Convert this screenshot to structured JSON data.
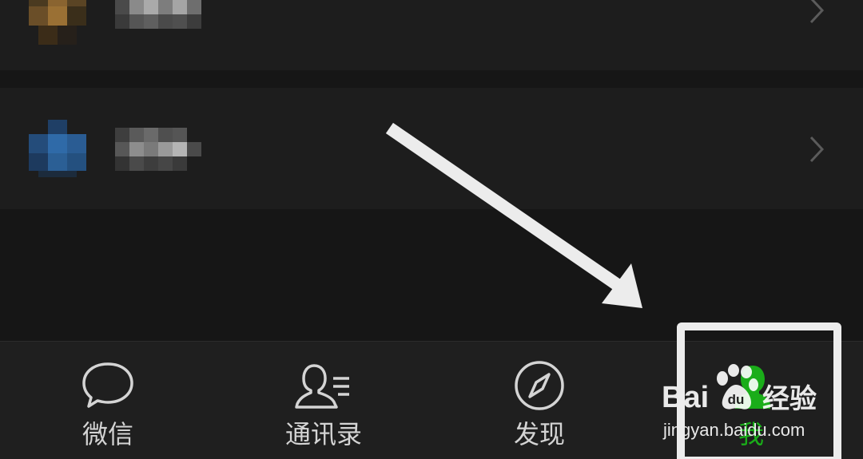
{
  "list": {
    "rows": [
      {
        "avatar_color": "#7a5a2e",
        "name": "",
        "chevron": "chevron-right-icon"
      },
      {
        "avatar_color": "#2b5f95",
        "name": "",
        "chevron": "chevron-right-icon"
      }
    ]
  },
  "tabbar": {
    "tabs": [
      {
        "label": "微信",
        "icon": "chat-bubble-icon",
        "active": false
      },
      {
        "label": "通讯录",
        "icon": "contacts-icon",
        "active": false
      },
      {
        "label": "发现",
        "icon": "compass-icon",
        "active": false
      },
      {
        "label": "我",
        "icon": "person-icon",
        "active": true
      }
    ]
  },
  "annotation": {
    "arrow": "arrow-pointer-icon",
    "box": "highlight-box"
  },
  "watermark": {
    "logo_text": "Bai",
    "logo_suffix": "经验",
    "url": "jingyan.baidu.com"
  },
  "colors": {
    "background": "#161616",
    "row": "#1d1d1d",
    "tabbar": "#1f1f1f",
    "active": "#1aad19",
    "inactive": "#d4d4d4",
    "annotation": "#ececec"
  }
}
